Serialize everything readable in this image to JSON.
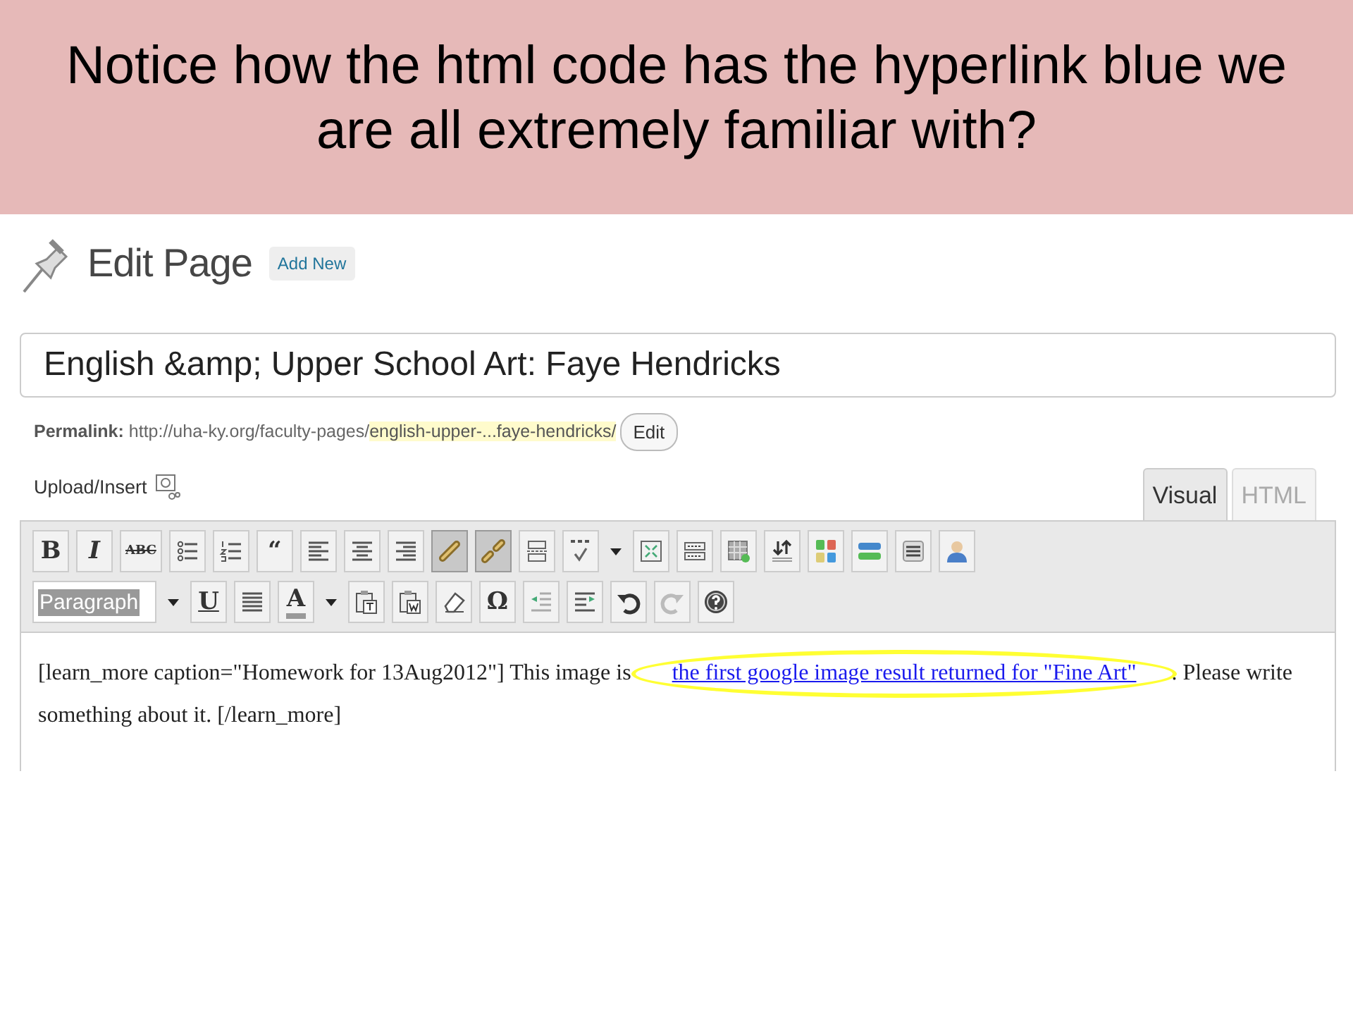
{
  "slide": {
    "title": "Notice how the html code has the hyperlink blue we are all extremely familiar with?"
  },
  "header": {
    "title": "Edit Page",
    "add_new": "Add New"
  },
  "post_title": {
    "value": "English &amp; Upper School Art: Faye Hendricks"
  },
  "permalink": {
    "label": "Permalink:",
    "base": "http://uha-ky.org/faculty-pages/",
    "slug": "english-upper-...faye-hendricks/",
    "edit": "Edit"
  },
  "upload_insert": {
    "label": "Upload/Insert"
  },
  "tabs": [
    {
      "label": "Visual",
      "selected": true
    },
    {
      "label": "HTML",
      "selected": false
    }
  ],
  "toolbar_rows": [
    [
      {
        "kind": "glyph",
        "label": "B",
        "pressed": false
      },
      {
        "kind": "glyph",
        "label": "I",
        "pressed": false
      },
      {
        "kind": "strike",
        "label": "ABC",
        "pressed": false
      },
      {
        "kind": "icon",
        "pressed": false
      },
      {
        "kind": "icon",
        "pressed": false
      },
      {
        "kind": "glyph",
        "label": "“",
        "pressed": false
      },
      {
        "kind": "icon",
        "pressed": false
      },
      {
        "kind": "icon",
        "pressed": false
      },
      {
        "kind": "icon",
        "pressed": false
      },
      {
        "kind": "icon",
        "pressed": true
      },
      {
        "kind": "icon",
        "pressed": true
      },
      {
        "kind": "icon",
        "pressed": false
      },
      {
        "kind": "icon",
        "pressed": false
      },
      {
        "kind": "caret",
        "pressed": false
      },
      {
        "kind": "icon",
        "pressed": false
      },
      {
        "kind": "icon",
        "pressed": false
      },
      {
        "kind": "icon",
        "pressed": false
      },
      {
        "kind": "icon",
        "pressed": false
      },
      {
        "kind": "icon",
        "pressed": false
      },
      {
        "kind": "icon",
        "pressed": false
      },
      {
        "kind": "icon",
        "pressed": false
      },
      {
        "kind": "icon",
        "pressed": false
      }
    ],
    [
      {
        "kind": "select",
        "label": "Paragraph",
        "pressed": false
      },
      {
        "kind": "caret",
        "pressed": false
      },
      {
        "kind": "underline",
        "label": "U",
        "pressed": false
      },
      {
        "kind": "icon",
        "pressed": false
      },
      {
        "kind": "color",
        "label": "A",
        "pressed": false
      },
      {
        "kind": "caret",
        "pressed": false
      },
      {
        "kind": "icon",
        "pressed": false
      },
      {
        "kind": "icon",
        "pressed": false
      },
      {
        "kind": "icon",
        "pressed": false
      },
      {
        "kind": "glyph",
        "label": "Ω",
        "pressed": false
      },
      {
        "kind": "icon",
        "pressed": false
      },
      {
        "kind": "icon",
        "pressed": false
      },
      {
        "kind": "icon",
        "pressed": false
      },
      {
        "kind": "icon",
        "pressed": false
      },
      {
        "kind": "icon",
        "pressed": false
      }
    ]
  ],
  "content": {
    "before": "[learn_more caption=\"Homework for 13Aug2012\"] This image is ",
    "link": "the first google image result returned for \"Fine Art\"",
    "after": ". Please write something about it. [/learn_more]"
  },
  "annotation": {
    "kind": "ellipse"
  }
}
